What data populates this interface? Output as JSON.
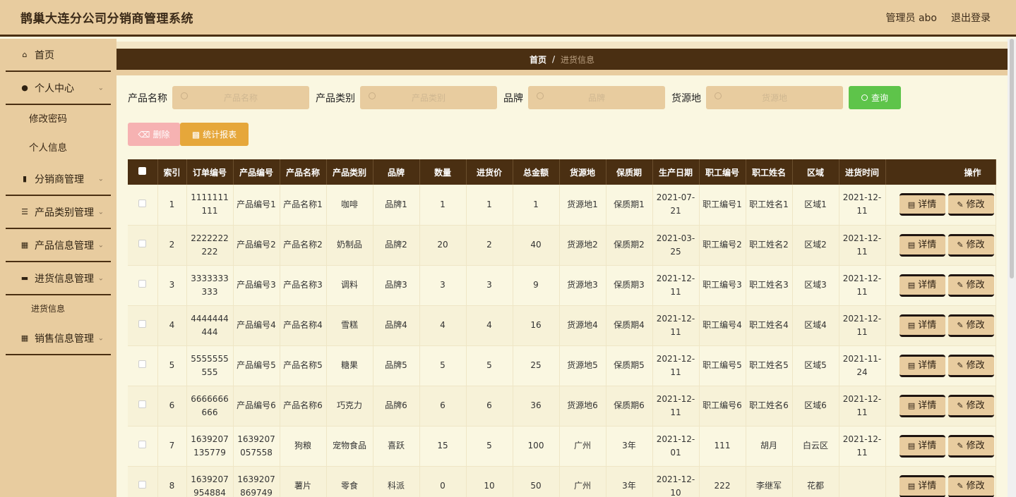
{
  "header": {
    "title": "鹊巢大连分公司分销商管理系统",
    "user": "管理员 abo",
    "logout": "退出登录"
  },
  "sidebar": {
    "home": "首页",
    "personal": "个人中心",
    "change_password": "修改密码",
    "personal_info": "个人信息",
    "distributor": "分销商管理",
    "category": "产品类别管理",
    "product_info": "产品信息管理",
    "purchase": "进货信息管理",
    "purchase_info": "进货信息",
    "sales": "销售信息管理"
  },
  "breadcrumb": {
    "home": "首页",
    "sep": "/",
    "current": "进货信息"
  },
  "search": {
    "product_name_label": "产品名称",
    "product_name_placeholder": "产品名称",
    "category_label": "产品类别",
    "category_placeholder": "产品类别",
    "brand_label": "品牌",
    "brand_placeholder": "品牌",
    "origin_label": "货源地",
    "origin_placeholder": "货源地",
    "query": "查询"
  },
  "toolbar": {
    "delete": "删除",
    "report": "统计报表"
  },
  "table": {
    "headers": [
      "索引",
      "订单编号",
      "产品编号",
      "产品名称",
      "产品类别",
      "品牌",
      "数量",
      "进货价",
      "总金额",
      "货源地",
      "保质期",
      "生产日期",
      "职工编号",
      "职工姓名",
      "区域",
      "进货时间",
      "操作"
    ],
    "detail_label": "详情",
    "edit_label": "修改",
    "rows": [
      [
        "1",
        "1111111111",
        "产品编号1",
        "产品名称1",
        "咖啡",
        "品牌1",
        "1",
        "1",
        "1",
        "货源地1",
        "保质期1",
        "2021-07-21",
        "职工编号1",
        "职工姓名1",
        "区域1",
        "2021-12-11"
      ],
      [
        "2",
        "2222222222",
        "产品编号2",
        "产品名称2",
        "奶制品",
        "品牌2",
        "20",
        "2",
        "40",
        "货源地2",
        "保质期2",
        "2021-03-25",
        "职工编号2",
        "职工姓名2",
        "区域2",
        "2021-12-11"
      ],
      [
        "3",
        "3333333333",
        "产品编号3",
        "产品名称3",
        "调料",
        "品牌3",
        "3",
        "3",
        "9",
        "货源地3",
        "保质期3",
        "2021-12-11",
        "职工编号3",
        "职工姓名3",
        "区域3",
        "2021-12-11"
      ],
      [
        "4",
        "4444444444",
        "产品编号4",
        "产品名称4",
        "雪糕",
        "品牌4",
        "4",
        "4",
        "16",
        "货源地4",
        "保质期4",
        "2021-12-11",
        "职工编号4",
        "职工姓名4",
        "区域4",
        "2021-12-11"
      ],
      [
        "5",
        "5555555555",
        "产品编号5",
        "产品名称5",
        "糖果",
        "品牌5",
        "5",
        "5",
        "25",
        "货源地5",
        "保质期5",
        "2021-12-11",
        "职工编号5",
        "职工姓名5",
        "区域5",
        "2021-11-24"
      ],
      [
        "6",
        "6666666666",
        "产品编号6",
        "产品名称6",
        "巧克力",
        "品牌6",
        "6",
        "6",
        "36",
        "货源地6",
        "保质期6",
        "2021-12-11",
        "职工编号6",
        "职工姓名6",
        "区域6",
        "2021-12-11"
      ],
      [
        "7",
        "1639207135779",
        "1639207057558",
        "狗粮",
        "宠物食品",
        "喜跃",
        "15",
        "5",
        "100",
        "广州",
        "3年",
        "2021-12-01",
        "111",
        "胡月",
        "白云区",
        "2021-12-11"
      ],
      [
        "8",
        "1639207954884",
        "1639207869749",
        "薯片",
        "零食",
        "科派",
        "0",
        "10",
        "50",
        "广州",
        "3年",
        "2021-12-10",
        "222",
        "李继军",
        "花都",
        ""
      ]
    ]
  }
}
